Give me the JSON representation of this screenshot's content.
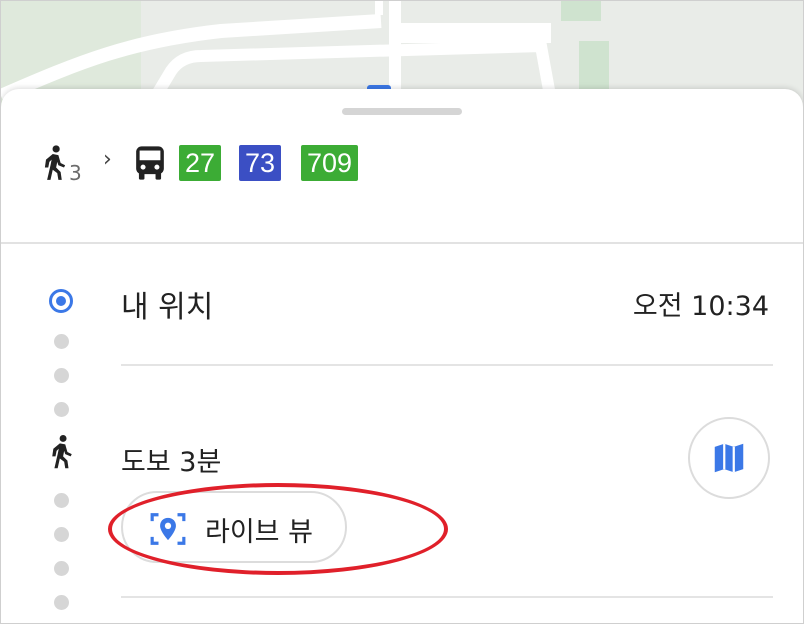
{
  "summary": {
    "walk_minutes": "3",
    "chevron": "›",
    "bus_routes": [
      {
        "label": "27",
        "color": "#3cac35"
      },
      {
        "label": "73",
        "color": "#3b4fc4"
      },
      {
        "label": "709",
        "color": "#3cac35"
      }
    ]
  },
  "steps": {
    "start_label": "내 위치",
    "start_time": "오전 10:34",
    "walk_label": "도보 3분",
    "live_view_label": "라이브 뷰"
  },
  "colors": {
    "accent_blue": "#3b78e7",
    "highlight_red": "#e0202a"
  },
  "icons": {
    "walk": "walk-icon",
    "bus": "bus-icon",
    "location": "location-dot-icon",
    "map": "map-icon",
    "live_view": "live-view-icon"
  }
}
